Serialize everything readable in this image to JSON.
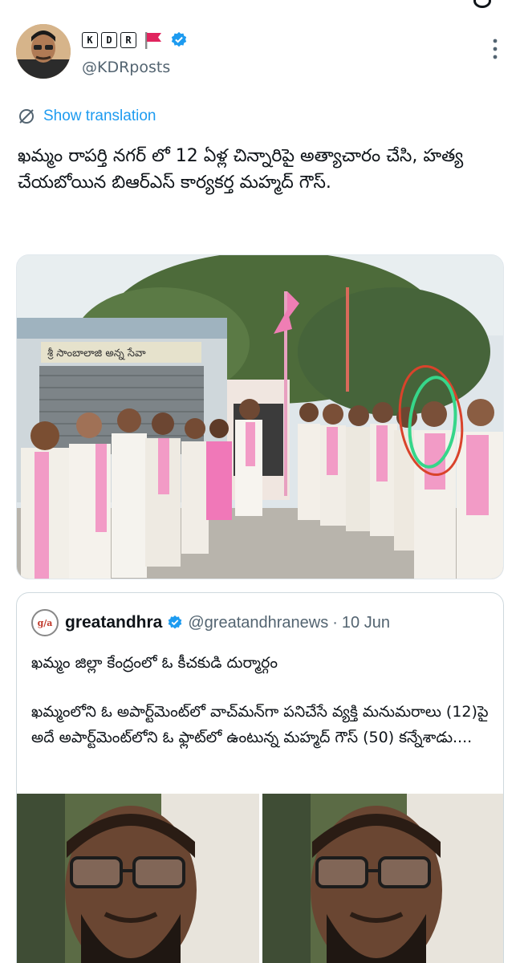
{
  "author": {
    "name_letters": [
      "K",
      "D",
      "R"
    ],
    "handle": "@KDRposts"
  },
  "translate": {
    "label": "Show translation"
  },
  "tweet": {
    "text": "ఖమ్మం రాపర్తి నగర్ లో 12 ఏళ్ల చిన్నారిపై అత్యాచారం చేసి, హత్య చేయబోయిన బిఆర్ఎస్ కార్యకర్త మహ్మద్ గౌస్."
  },
  "photo": {
    "shop_sign": "శ్రీ సాంబాలాజి అన్న సేవా"
  },
  "quote": {
    "logo": "g/a",
    "name": "greatandhra",
    "handle": "@greatandhranews",
    "dot": "·",
    "date": "10 Jun",
    "line1": "ఖమ్మం జిల్లా కేంద్రంలో ఓ కీచకుడి దుర్మార్గం",
    "body": "ఖమ్మంలోని ఓ అపార్ట్‌మెంట్‌లో వాచ్‌మన్‌గా పనిచేసే వ్యక్తి మనుమరాలు (12)పై అదే అపార్ట్‌మెంట్‌లోని ఓ ఫ్లాట్‌లో ఉంటున్న మహ్మద్ గౌస్ (50) కన్నేశాడు...."
  },
  "colors": {
    "accent_blue": "#1d9bf0",
    "secondary_text": "#536471",
    "party_pink": "#f29bc6"
  },
  "icons": [
    "flag-icon",
    "verified-icon",
    "more-icon",
    "translate-icon"
  ]
}
